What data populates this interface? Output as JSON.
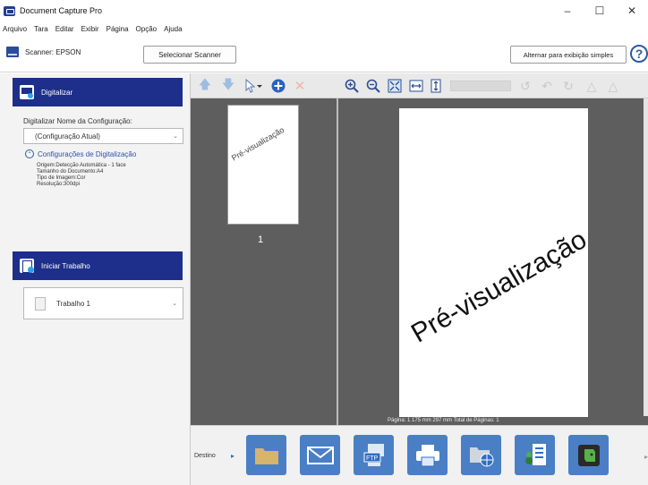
{
  "window": {
    "title": "Document Capture Pro",
    "minimize": "–",
    "maximize": "☐",
    "close": "✕"
  },
  "menu": [
    "Arquivo",
    "Tara",
    "Editar",
    "Exibir",
    "Página",
    "Opção",
    "Ajuda"
  ],
  "toolbar": {
    "scanner_label": "Scanner: EPSON",
    "select_scanner": "Selecionar Scanner",
    "simple_view": "Alternar para exibição simples",
    "help": "?"
  },
  "scan_section": {
    "title": "Digitalizar",
    "config_label": "Digitalizar Nome da Configuração:",
    "config_value": "(Configuração Atual)",
    "settings_link": "Configurações de Digitalização",
    "details": [
      "Origem:Detecção Automática - 1 face",
      "Tamanho do Documento:A4",
      "Tipo de Imagem:Cor",
      "Resolução:300dpi"
    ]
  },
  "job_section": {
    "title": "Iniciar Trabalho",
    "job_value": "Trabalho 1"
  },
  "thumbnails": [
    {
      "label": "Pré-visualização",
      "number": "1"
    }
  ],
  "preview": {
    "watermark": "Pré-visualização",
    "page_info": "Página: 1    175 mm    297 mm   Total de Páginas: 1"
  },
  "destination": {
    "label": "Destino",
    "items": [
      "folder",
      "email",
      "ftp",
      "print",
      "web-folder",
      "sharepoint",
      "evernote"
    ]
  },
  "colors": {
    "accent": "#1d2f8a",
    "dest_button": "#4a7fc6",
    "view_bg": "#5e5e5e"
  }
}
